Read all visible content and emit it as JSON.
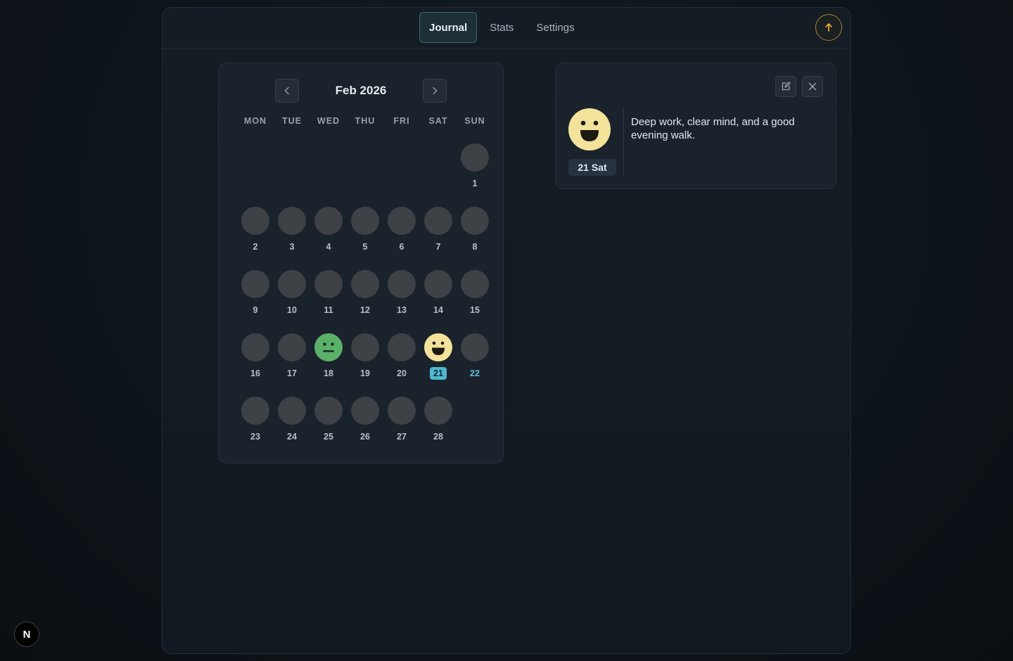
{
  "tabs": [
    {
      "label": "Journal",
      "active": true
    },
    {
      "label": "Stats",
      "active": false
    },
    {
      "label": "Settings",
      "active": false
    }
  ],
  "header": {
    "scroll_top_icon": "arrow-up-icon",
    "accent": "#a8823a"
  },
  "calendar": {
    "month_label": "Feb 2026",
    "prev_icon": "chevron-left-icon",
    "next_icon": "chevron-right-icon",
    "weekdays": [
      "MON",
      "TUE",
      "WED",
      "THU",
      "FRI",
      "SAT",
      "SUN"
    ],
    "first_weekday_index": 6,
    "days": [
      {
        "n": "1"
      },
      {
        "n": "2"
      },
      {
        "n": "3"
      },
      {
        "n": "4"
      },
      {
        "n": "5"
      },
      {
        "n": "6"
      },
      {
        "n": "7"
      },
      {
        "n": "8"
      },
      {
        "n": "9"
      },
      {
        "n": "10"
      },
      {
        "n": "11"
      },
      {
        "n": "12"
      },
      {
        "n": "13"
      },
      {
        "n": "14"
      },
      {
        "n": "15"
      },
      {
        "n": "16"
      },
      {
        "n": "17"
      },
      {
        "n": "18",
        "mood": "neutral",
        "color": "#5bb06a"
      },
      {
        "n": "19"
      },
      {
        "n": "20"
      },
      {
        "n": "21",
        "mood": "happy",
        "color": "#f3e39a",
        "selected": true
      },
      {
        "n": "22",
        "today": true
      },
      {
        "n": "23"
      },
      {
        "n": "24"
      },
      {
        "n": "25"
      },
      {
        "n": "26"
      },
      {
        "n": "27"
      },
      {
        "n": "28"
      }
    ],
    "empty_color": "#3e4247",
    "selected_color": "#4fb8cf"
  },
  "entry": {
    "mood": "happy",
    "mood_color": "#f3e39a",
    "date_label": "21 Sat",
    "note": "Deep work, clear mind, and a good evening walk.",
    "edit_icon": "edit-icon",
    "close_icon": "close-icon"
  },
  "badge": {
    "label": "N"
  }
}
